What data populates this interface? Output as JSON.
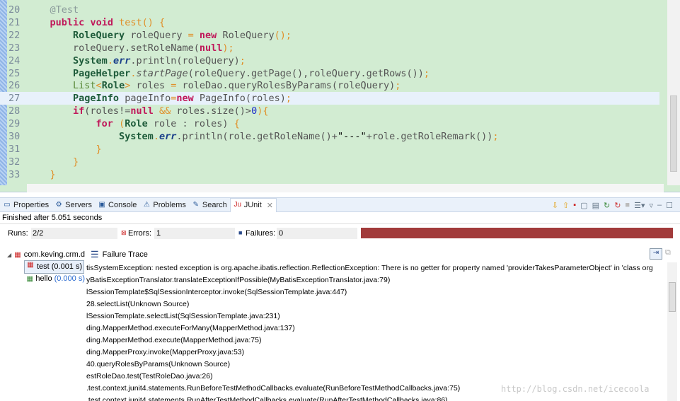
{
  "editor": {
    "lines": [
      {
        "n": "20",
        "html": "    <span class='a'>@Test</span>"
      },
      {
        "n": "21",
        "html": "    <span class='k'>public</span> <span class='k'>void</span> <span class='p'>test() {</span>"
      },
      {
        "n": "22",
        "html": "        <span class='t'>RoleQuery</span> <span class='m'>roleQuery</span> <span class='p'>=</span> <span class='k'>new</span> <span class='m'>RoleQuery</span><span class='p'>();</span>"
      },
      {
        "n": "23",
        "html": "        <span class='m'>roleQuery.setRoleName(</span><span class='k'>null</span><span class='p'>);</span>"
      },
      {
        "n": "24",
        "html": "        <span class='t'>System</span><span class='p'>.</span><span class='i'>err</span><span class='m'>.println(roleQuery)</span><span class='p'>;</span>"
      },
      {
        "n": "25",
        "html": "        <span class='t'>PageHelper</span><span class='p'>.</span><i class='m'>startPage</i><span class='m'>(roleQuery.getPage(),roleQuery.getRows())</span><span class='p'>;</span>"
      },
      {
        "n": "26",
        "html": "        <span class='g'>List</span><span class='p'>&lt;</span><span class='t'>Role</span><span class='p'>&gt;</span> <span class='m'>roles</span> <span class='p'>=</span> <span class='m'>roleDao.queryRolesByParams(roleQuery)</span><span class='p'>;</span>"
      },
      {
        "n": "27",
        "html": "        <span class='t'>PageInfo</span> <span class='m'>pageInfo</span><span class='p'>=</span><span class='k'>new</span> <span class='m'>PageInfo(roles)</span><span class='p'>;</span>"
      },
      {
        "n": "28",
        "html": "        <span class='k'>if</span><span class='m'>(roles!=</span><span class='k'>null</span> <span class='p'>&amp;&amp;</span> <span class='m'>roles.size()&gt;</span><span class='n'>0</span><span class='p'>){</span>"
      },
      {
        "n": "29",
        "html": "            <span class='k'>for</span> <span class='p'>(</span><span class='t'>Role</span> <span class='m'>role : roles)</span> <span class='p'>{</span>"
      },
      {
        "n": "30",
        "html": "                <span class='t'>System</span><span class='p'>.</span><span class='i'>err</span><span class='m'>.println(role.getRoleName()+</span>\"---\"<span class='m'>+role.getRoleRemark())</span><span class='p'>;</span>"
      },
      {
        "n": "31",
        "html": "            <span class='p'>}</span>"
      },
      {
        "n": "32",
        "html": "        <span class='p'>}</span>"
      },
      {
        "n": "33",
        "html": "    <span class='p'>}</span>"
      }
    ]
  },
  "tabs": [
    {
      "label": "Properties",
      "icon": "▭"
    },
    {
      "label": "Servers",
      "icon": "⚙"
    },
    {
      "label": "Console",
      "icon": "▣"
    },
    {
      "label": "Problems",
      "icon": "⚠"
    },
    {
      "label": "Search",
      "icon": "✎"
    },
    {
      "label": "JUnit",
      "icon": "Ju"
    }
  ],
  "junit": {
    "finished": "Finished after 5.051 seconds",
    "runs_label": "Runs:",
    "runs": "2/2",
    "errors_label": "Errors:",
    "errors": "1",
    "failures_label": "Failures:",
    "failures": "0",
    "progress": 1.0,
    "bar_color": "#a23b3b",
    "tree": [
      {
        "label": "com.keving.crm.d",
        "time": ""
      },
      {
        "label": "test",
        "time": "(0.001 s)"
      },
      {
        "label": "hello",
        "time": "(0.000 s)"
      }
    ],
    "trace_title": "Failure Trace",
    "trace": [
      "tisSystemException: nested exception is org.apache.ibatis.reflection.ReflectionException: There is no getter for property named 'providerTakesParameterObject' in 'class org",
      "yBatisExceptionTranslator.translateExceptionIfPossible(MyBatisExceptionTranslator.java:79)",
      "lSessionTemplate$SqlSessionInterceptor.invoke(SqlSessionTemplate.java:447)",
      "28.selectList(Unknown Source)",
      "lSessionTemplate.selectList(SqlSessionTemplate.java:231)",
      "ding.MapperMethod.executeForMany(MapperMethod.java:137)",
      "ding.MapperMethod.execute(MapperMethod.java:75)",
      "ding.MapperProxy.invoke(MapperProxy.java:53)",
      "40.queryRolesByParams(Unknown Source)",
      "estRoleDao.test(TestRoleDao.java:26)",
      ".test.context.junit4.statements.RunBeforeTestMethodCallbacks.evaluate(RunBeforeTestMethodCallbacks.java:75)",
      ".test.context.junit4.statements.RunAfterTestMethodCallbacks.evaluate(RunAfterTestMethodCallbacks.java:86)"
    ]
  },
  "watermark": "http://blog.csdn.net/icecoola"
}
